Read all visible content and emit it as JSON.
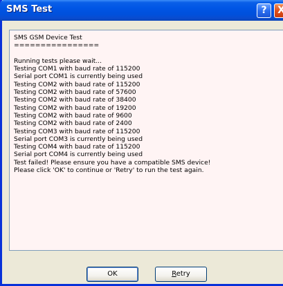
{
  "window": {
    "title": "SMS Test",
    "help_glyph": "?",
    "close_glyph": "X"
  },
  "log": {
    "lines": [
      "SMS GSM Device Test",
      "================",
      "",
      "Running tests please wait...",
      "Testing COM1 with baud rate of 115200",
      "Serial port COM1 is currently being used",
      "Testing COM2 with baud rate of 115200",
      "Testing COM2 with baud rate of 57600",
      "Testing COM2 with baud rate of 38400",
      "Testing COM2 with baud rate of 19200",
      "Testing COM2 with baud rate of 9600",
      "Testing COM2 with baud rate of 2400",
      "Testing COM3 with baud rate of 115200",
      "Serial port COM3 is currently being used",
      "Testing COM4 with baud rate of 115200",
      "Serial port COM4 is currently being used",
      "Test failed! Please ensure you have a compatible SMS device!",
      "Please click 'OK' to continue or 'Retry' to run the test again."
    ]
  },
  "buttons": {
    "ok_label": "OK",
    "retry_mnemonic": "R",
    "retry_rest": "etry"
  },
  "colors": {
    "titlebar": "#0055e5",
    "log_background": "#fff4f4",
    "dialog_background": "#ece9d8",
    "close_button": "#e0501c"
  },
  "icons": {
    "help": "help-icon",
    "close": "close-icon"
  }
}
